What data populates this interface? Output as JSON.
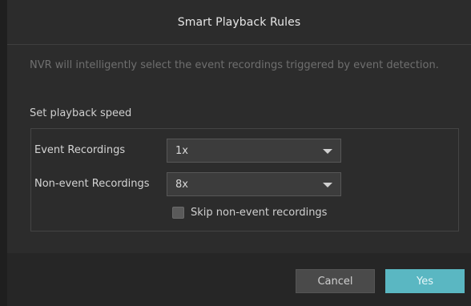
{
  "dialog": {
    "title": "Smart Playback Rules",
    "description": "NVR will intelligently select the event recordings triggered by event detection.",
    "section_label": "Set playback speed",
    "event_recordings": {
      "label": "Event Recordings",
      "value": "1x"
    },
    "non_event_recordings": {
      "label": "Non-event Recordings",
      "value": "8x"
    },
    "skip_checkbox": {
      "label": "Skip non-event recordings",
      "checked": false
    },
    "buttons": {
      "cancel": "Cancel",
      "yes": "Yes"
    }
  },
  "colors": {
    "accent": "#5ab7c2",
    "background": "#2c2c2c"
  }
}
